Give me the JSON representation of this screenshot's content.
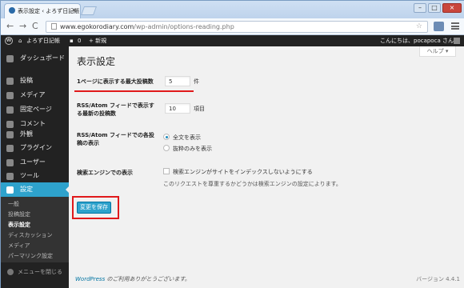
{
  "browser": {
    "tab_title": "表示設定 ‹ よろず日記帳 — …",
    "tab_close": "×",
    "url_host": "www.egokorodiary.com",
    "url_path": "/wp-admin/options-reading.php",
    "nav_back": "←",
    "nav_forward": "→",
    "nav_reload": "C",
    "star": "☆",
    "min": "–",
    "max": "□",
    "close": "×"
  },
  "adminbar": {
    "logo": "W",
    "site_name": "よろず日記帳",
    "comments_count": "0",
    "new_label": "+ 新規",
    "greeting": "こんにちは、pocapoca さん!"
  },
  "sidebar": {
    "items": [
      {
        "label": "ダッシュボード",
        "icon": "dashboard-icon"
      },
      {
        "label": "投稿",
        "icon": "pin-icon"
      },
      {
        "label": "メディア",
        "icon": "media-icon"
      },
      {
        "label": "固定ページ",
        "icon": "page-icon"
      },
      {
        "label": "コメント",
        "icon": "comment-icon"
      },
      {
        "label": "外観",
        "icon": "brush-icon"
      },
      {
        "label": "プラグイン",
        "icon": "plugin-icon"
      },
      {
        "label": "ユーザー",
        "icon": "user-icon"
      },
      {
        "label": "ツール",
        "icon": "wrench-icon"
      },
      {
        "label": "設定",
        "icon": "settings-icon"
      }
    ],
    "submenu": [
      "一般",
      "投稿設定",
      "表示設定",
      "ディスカッション",
      "メディア",
      "パーマリンク設定"
    ],
    "collapse": "メニューを閉じる"
  },
  "content": {
    "help": "ヘルプ ▾",
    "title": "表示設定",
    "posts_per_page_label": "1ページに表示する最大投稿数",
    "posts_per_page_value": "5",
    "posts_per_page_unit": "件",
    "rss_count_label": "RSS/Atom フィードで表示する最新の投稿数",
    "rss_count_value": "10",
    "rss_count_unit": "項目",
    "rss_display_label": "RSS/Atom フィードでの各投稿の表示",
    "rss_full": "全文を表示",
    "rss_summary": "抜粋のみを表示",
    "search_label": "検索エンジンでの表示",
    "search_checkbox": "検索エンジンがサイトをインデックスしないようにする",
    "search_desc": "このリクエストを尊重するかどうかは検索エンジンの設定によります。",
    "save_button": "変更を保存",
    "footer_link": "WordPress",
    "footer_text": " のご利用ありがとうございます。",
    "version": "バージョン 4.4.1"
  }
}
